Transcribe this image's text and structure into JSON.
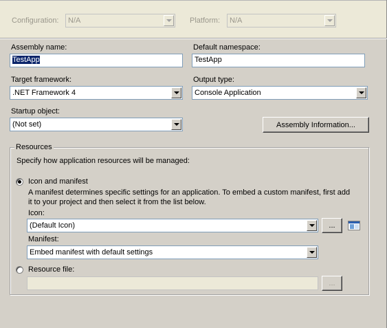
{
  "header": {
    "configuration_label": "Configuration:",
    "configuration_value": "N/A",
    "platform_label": "Platform:",
    "platform_value": "N/A"
  },
  "assembly": {
    "name_label": "Assembly name:",
    "name_value": "TestApp",
    "namespace_label": "Default namespace:",
    "namespace_value": "TestApp"
  },
  "framework": {
    "target_label": "Target framework:",
    "target_value": ".NET Framework 4",
    "output_label": "Output type:",
    "output_value": "Console Application"
  },
  "startup": {
    "label": "Startup object:",
    "value": "(Not set)",
    "assembly_info_button": "Assembly Information..."
  },
  "resources": {
    "group_title": "Resources",
    "description": "Specify how application resources will be managed:",
    "icon_manifest_label": "Icon and manifest",
    "icon_manifest_selected": true,
    "help_line1": "A manifest determines specific settings for an application. To embed a custom manifest, first add",
    "help_line2": "it to your project and then select it from the list below.",
    "icon_label": "Icon:",
    "icon_value": "(Default Icon)",
    "browse_label": "...",
    "manifest_label": "Manifest:",
    "manifest_value": "Embed manifest with default settings",
    "resource_file_label": "Resource file:",
    "resource_file_value": "",
    "resource_browse_label": "..."
  },
  "icons": [
    "dropdown-arrow-icon",
    "app-icon-preview"
  ],
  "colors": {
    "background": "#d4d0c8",
    "selection": "#0a246a",
    "input_border": "#7f9db9"
  }
}
